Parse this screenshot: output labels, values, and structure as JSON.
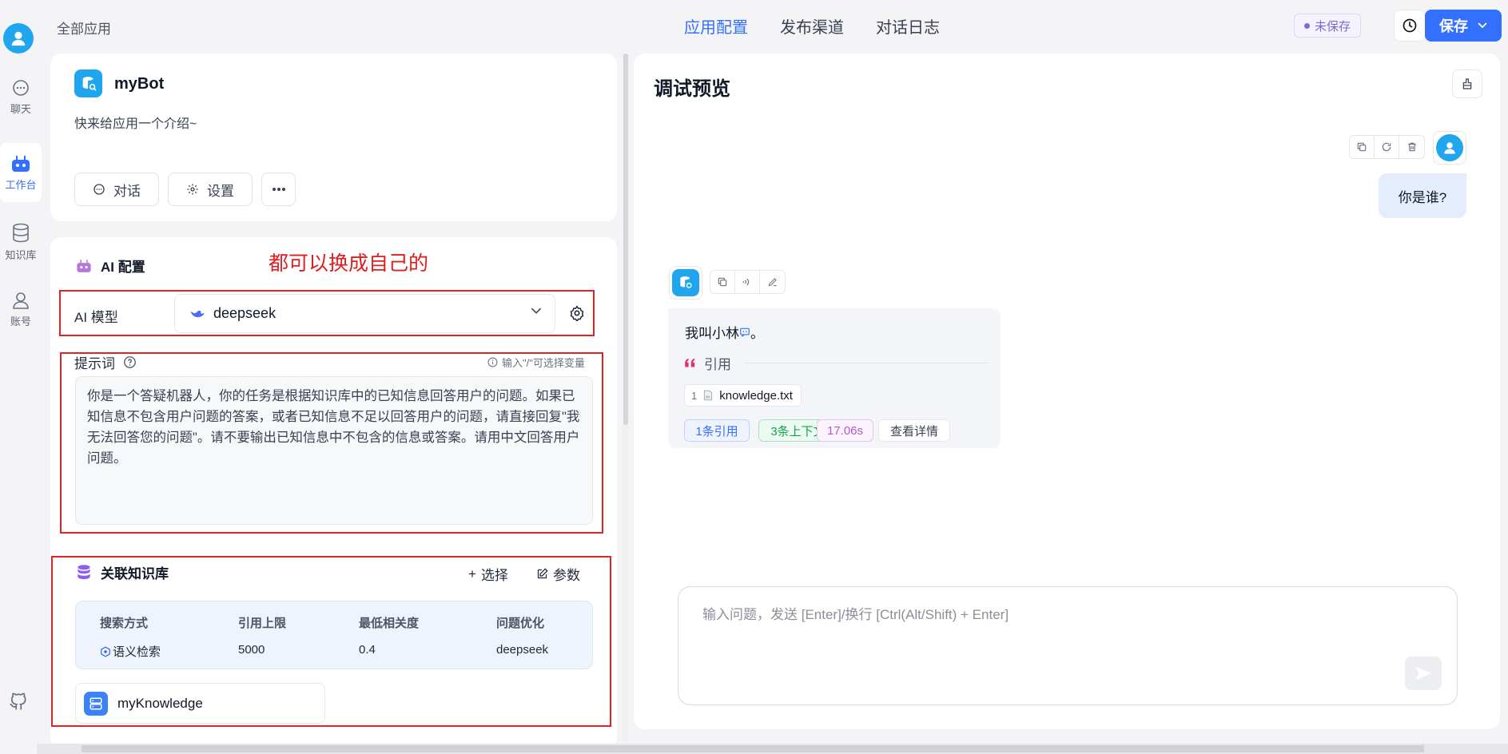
{
  "rail": {
    "items": [
      {
        "label": "聊天",
        "icon": "chat-icon"
      },
      {
        "label": "工作台",
        "icon": "robot-icon"
      },
      {
        "label": "知识库",
        "icon": "database-icon"
      },
      {
        "label": "账号",
        "icon": "user-icon"
      }
    ]
  },
  "topbar": {
    "breadcrumb": "全部应用",
    "tabs": [
      "应用配置",
      "发布渠道",
      "对话日志"
    ],
    "unsaved": "未保存",
    "save_label": "保存"
  },
  "app": {
    "name": "myBot",
    "intro": "快来给应用一个介绍~",
    "chat_btn": "对话",
    "settings_btn": "设置"
  },
  "ai_config": {
    "title": "AI 配置",
    "annotation": "都可以换成自己的",
    "model_label": "AI 模型",
    "model_value": "deepseek",
    "prompt_label": "提示词",
    "prompt_hint": "输入\"/\"可选择变量",
    "prompt_text": "你是一个答疑机器人，你的任务是根据知识库中的已知信息回答用户的问题。如果已知信息不包含用户问题的答案，或者已知信息不足以回答用户的问题，请直接回复\"我无法回答您的问题\"。请不要输出已知信息中不包含的信息或答案。请用中文回答用户问题。"
  },
  "knowledge": {
    "title": "关联知识库",
    "select_label": "选择",
    "params_label": "参数",
    "headers": [
      "搜索方式",
      "引用上限",
      "最低相关度",
      "问题优化"
    ],
    "values": [
      "语义检索",
      "5000",
      "0.4",
      "deepseek"
    ],
    "item_name": "myKnowledge"
  },
  "debug": {
    "title": "调试预览",
    "user_message": "你是谁?",
    "bot_answer": "我叫小林",
    "bot_answer_tail": "。",
    "quote_label": "引用",
    "source_index": "1",
    "source_file": "knowledge.txt",
    "tags": {
      "quotes": "1条引用",
      "context": "3条上下文",
      "time": "17.06s",
      "details": "查看详情"
    },
    "input_placeholder": "输入问题，发送 [Enter]/换行 [Ctrl(Alt/Shift) + Enter]"
  },
  "colors": {
    "accent": "#3370ff",
    "annotation_red": "#e02424",
    "avatar_blue": "#1fa6ee"
  }
}
